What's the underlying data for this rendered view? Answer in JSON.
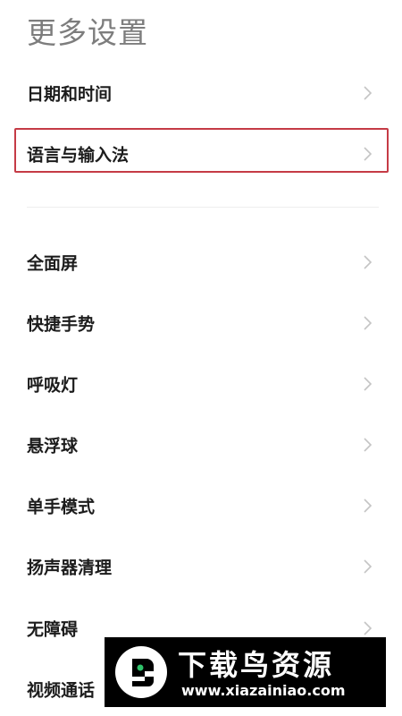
{
  "header": {
    "title": "更多设置"
  },
  "group1": [
    {
      "label": "日期和时间"
    },
    {
      "label": "语言与输入法"
    }
  ],
  "group2": [
    {
      "label": "全面屏"
    },
    {
      "label": "快捷手势"
    },
    {
      "label": "呼吸灯"
    },
    {
      "label": "悬浮球"
    },
    {
      "label": "单手模式"
    },
    {
      "label": "扬声器清理"
    },
    {
      "label": "无障碍"
    },
    {
      "label": "视频通话"
    }
  ],
  "colors": {
    "highlight": "#c53b46",
    "title": "#7d7d7d",
    "chevron": "#c4c4c4"
  },
  "watermark": {
    "title": "下载鸟资源",
    "url": "www.xiazainiao.com"
  }
}
